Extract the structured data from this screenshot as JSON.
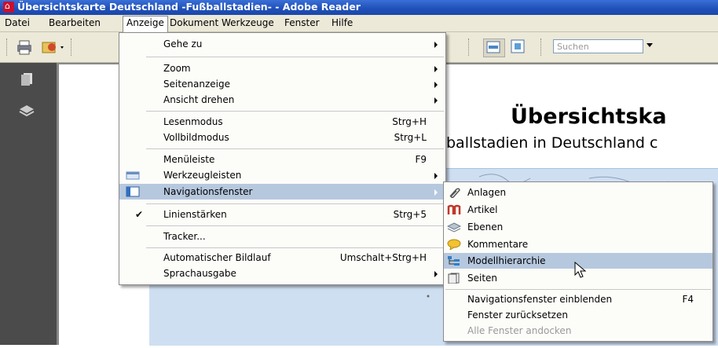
{
  "window": {
    "title": "Übersichtskarte Deutschland -Fußballstadien- - Adobe Reader"
  },
  "menubar": [
    "Datei",
    "Bearbeiten",
    "Anzeige",
    "Dokument",
    "Werkzeuge",
    "Fenster",
    "Hilfe"
  ],
  "toolbar": {
    "search_placeholder": "Suchen"
  },
  "document": {
    "title": "Übersichtska",
    "subtitle": "ballstadien in Deutschland c"
  },
  "anzeige_menu": [
    {
      "label": "Gehe zu",
      "submenu": true
    },
    {
      "label": "Zoom",
      "submenu": true
    },
    {
      "label": "Seitenanzeige",
      "submenu": true
    },
    {
      "label": "Ansicht drehen",
      "submenu": true
    },
    {
      "label": "Lesenmodus",
      "shortcut": "Strg+H"
    },
    {
      "label": "Vollbildmodus",
      "shortcut": "Strg+L"
    },
    {
      "label": "Menüleiste",
      "shortcut": "F9"
    },
    {
      "label": "Werkzeugleisten",
      "submenu": true
    },
    {
      "label": "Navigationsfenster",
      "submenu": true,
      "highlighted": true
    },
    {
      "label": "Linienstärken",
      "shortcut": "Strg+5",
      "checked": true
    },
    {
      "label": "Tracker..."
    },
    {
      "label": "Automatischer Bildlauf",
      "shortcut": "Umschalt+Strg+H"
    },
    {
      "label": "Sprachausgabe",
      "submenu": true
    }
  ],
  "nav_submenu": [
    {
      "label": "Anlagen",
      "icon": "paperclip-icon"
    },
    {
      "label": "Artikel",
      "icon": "article-icon"
    },
    {
      "label": "Ebenen",
      "icon": "layers-icon"
    },
    {
      "label": "Kommentare",
      "icon": "comment-icon"
    },
    {
      "label": "Modellhierarchie",
      "icon": "model-tree-icon",
      "highlighted": true
    },
    {
      "label": "Seiten",
      "icon": "pages-icon"
    },
    {
      "label": "Navigationsfenster einblenden",
      "shortcut": "F4"
    },
    {
      "label": "Fenster zurücksetzen"
    },
    {
      "label": "Alle Fenster andocken",
      "disabled": true
    }
  ]
}
